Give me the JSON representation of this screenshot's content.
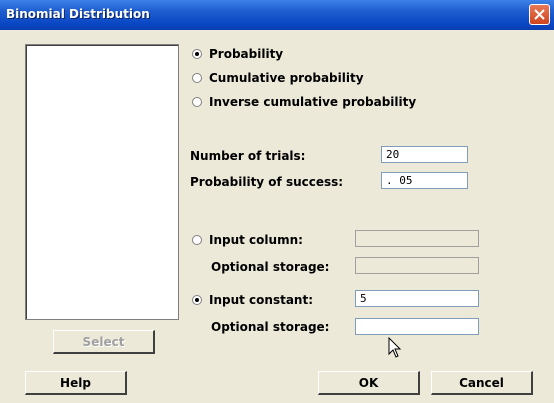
{
  "window": {
    "title": "Binomial Distribution"
  },
  "distribution_options": [
    {
      "label": "Probability",
      "checked": true
    },
    {
      "label": "Cumulative probability",
      "checked": false
    },
    {
      "label": "Inverse cumulative probability",
      "checked": false
    }
  ],
  "number_of_trials": {
    "label": "Number of trials:",
    "value": "20"
  },
  "probability_of_success": {
    "label": "Probability of success:",
    "value": ". 05"
  },
  "input_column": {
    "label": "Input column:",
    "checked": false,
    "value": ""
  },
  "optional_storage_1": {
    "label": "Optional storage:",
    "value": ""
  },
  "input_constant": {
    "label": "Input constant:",
    "checked": true,
    "value": "5"
  },
  "optional_storage_2": {
    "label": "Optional storage:",
    "value": ""
  },
  "buttons": {
    "select": "Select",
    "help": "Help",
    "ok": "OK",
    "cancel": "Cancel"
  },
  "colors": {
    "titlebar": "#0a46c4",
    "dialog_bg": "#ece9d8",
    "close": "#d0441f"
  }
}
